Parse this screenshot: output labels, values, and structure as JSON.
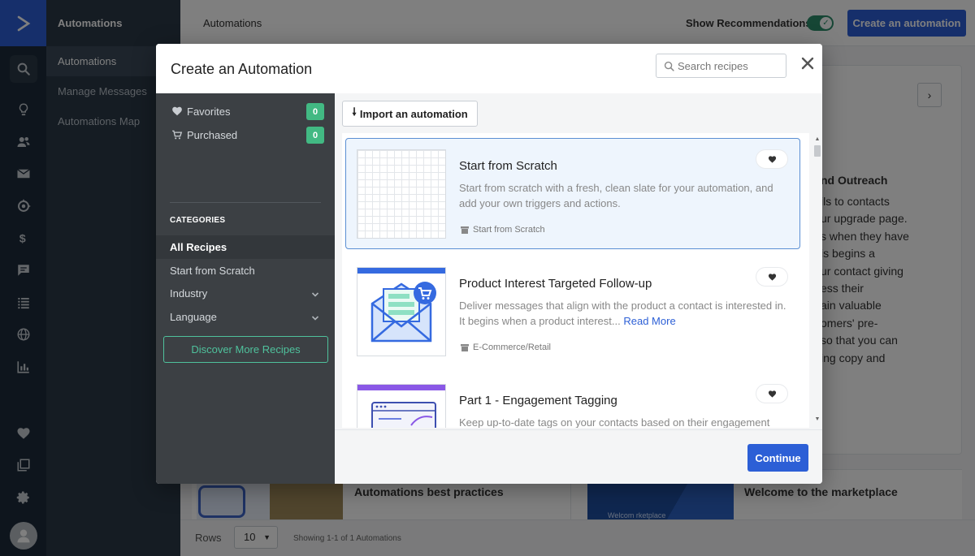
{
  "rail": {
    "icons": [
      "logo-chevron-icon",
      "search-icon",
      "lightbulb-icon",
      "contacts-icon",
      "mail-icon",
      "automations-icon",
      "dollar-icon",
      "chat-icon",
      "list-icon",
      "globe-icon",
      "reports-icon",
      "heart-icon",
      "pages-icon",
      "gear-icon",
      "avatar-icon"
    ]
  },
  "subnav": {
    "title": "Automations",
    "items": [
      {
        "label": "Automations"
      },
      {
        "label": "Manage Messages"
      },
      {
        "label": "Automations Map"
      }
    ]
  },
  "header": {
    "title": "Automations",
    "recommendations_label": "Show Recommendations",
    "recommendations_on": true,
    "create_label": "Create an automation"
  },
  "background": {
    "card_heading": "nd Outreach",
    "card_lines": [
      "ils to contacts",
      "ur upgrade page.",
      "s when they have",
      "is begins a",
      "ur contact giving",
      "ess their",
      "ain valuable",
      "omers' pre-",
      "so that you can",
      "ing copy and"
    ],
    "link1": "Automations best practices",
    "link2": "Welcome to the marketplace",
    "thumb2_text": "Welcom                   rketplace",
    "rows_label": "Rows",
    "rows_value": "10",
    "showing": "Showing 1-1 of 1 Automations"
  },
  "modal": {
    "title": "Create an Automation",
    "search_placeholder": "Search recipes",
    "favorites": {
      "label": "Favorites",
      "count": "0"
    },
    "purchased": {
      "label": "Purchased",
      "count": "0"
    },
    "categories_label": "CATEGORIES",
    "categories": [
      {
        "label": "All Recipes"
      },
      {
        "label": "Start from Scratch"
      },
      {
        "label": "Industry"
      },
      {
        "label": "Language"
      }
    ],
    "discover_label": "Discover More Recipes",
    "import_label": "Import an automation",
    "continue_label": "Continue",
    "recipes": [
      {
        "title": "Start from Scratch",
        "description": "Start from scratch with a fresh, clean slate for your automation, and add your own triggers and actions.",
        "tag": "Start from Scratch"
      },
      {
        "title": "Product Interest Targeted Follow-up",
        "description": "Deliver messages that align with the product a contact is interested in. It begins when a product interest...",
        "read_more": "Read More",
        "tag": "E-Commerce/Retail"
      },
      {
        "title": "Part 1 - Engagement Tagging",
        "description": "Keep up-to-date tags on your contacts based on their engagement level."
      }
    ]
  },
  "colors": {
    "brand_blue": "#2c5fd6",
    "success_green": "#42b983",
    "toggle_green": "#2d8c6a",
    "sidebar_dark": "#1c2a3a"
  }
}
